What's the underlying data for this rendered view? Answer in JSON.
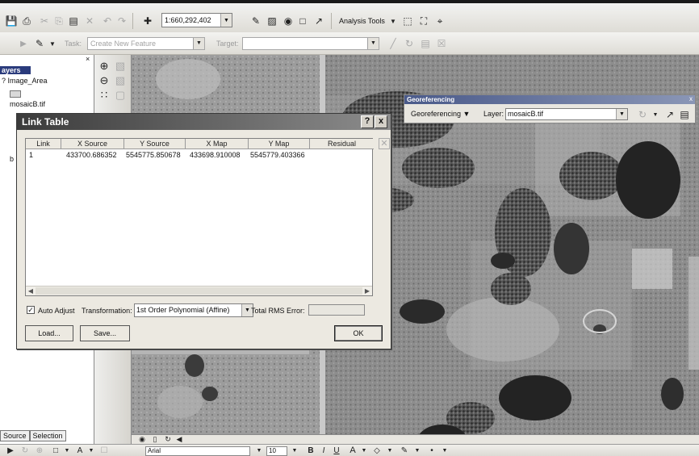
{
  "main_toolbar": {
    "map_scale": "1:660,292,402",
    "analysis_tools_label": "Analysis Tools"
  },
  "editor_toolbar": {
    "task_label": "Task:",
    "task_value": "Create New Feature",
    "target_label": "Target:"
  },
  "toc": {
    "title": "ayers",
    "items": [
      "Image_Area",
      "mosaicB.tif"
    ],
    "partial_label": "b",
    "tabs": [
      "Source",
      "Selection"
    ]
  },
  "georeferencing": {
    "title": "Georeferencing",
    "menu_label": "Georeferencing",
    "menu_hotkey": "G",
    "layer_label": "Layer:",
    "layer_value": "mosaicB.tif",
    "close_glyph": "x"
  },
  "link_table": {
    "title": "Link Table",
    "help_glyph": "?",
    "close_glyph": "x",
    "columns": [
      "Link",
      "X Source",
      "Y Source",
      "X Map",
      "Y Map",
      "Residual"
    ],
    "rows": [
      {
        "link": "1",
        "x_source": "433700.686352",
        "y_source": "5545775.850678",
        "x_map": "433698.910008",
        "y_map": "5545779.403366",
        "residual": ""
      }
    ],
    "auto_adjust_label": "Auto Adjust",
    "auto_adjust_checked": true,
    "transformation_label": "Transformation:",
    "transformation_value": "1st Order Polynomial (Affine)",
    "total_rms_label": "Total RMS Error:",
    "load_label": "Load...",
    "save_label": "Save...",
    "ok_label": "OK"
  },
  "draw_toolbar": {
    "font_name": "Arial",
    "font_size": "10"
  }
}
